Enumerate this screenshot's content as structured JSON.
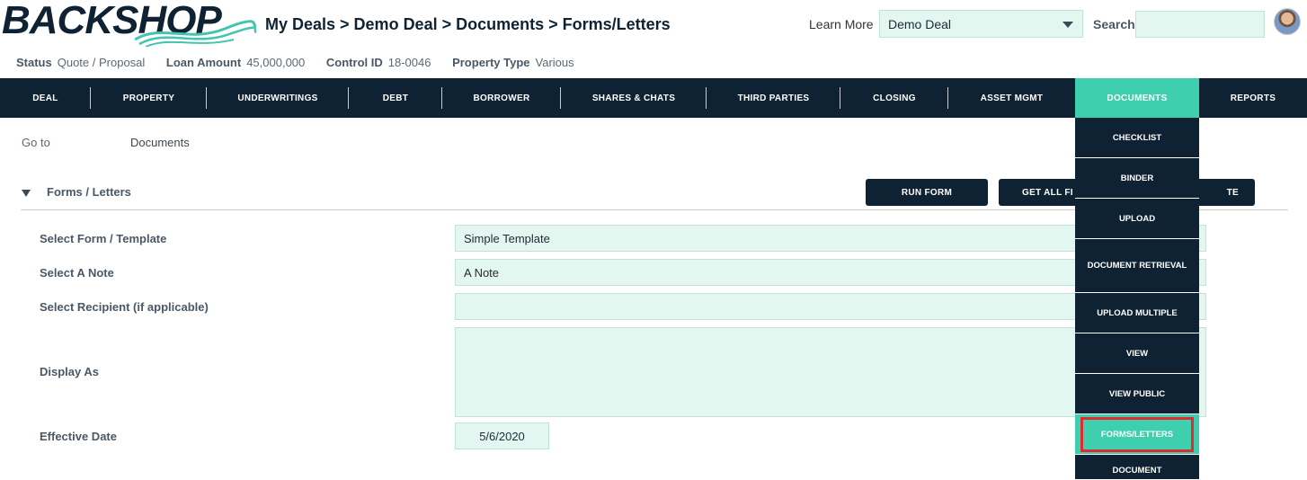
{
  "header": {
    "logo_text": "BACKSHOP",
    "breadcrumb": "My Deals > Demo Deal > Documents > Forms/Letters",
    "learn_more": "Learn More",
    "deal_select": "Demo Deal",
    "search_label": "Search",
    "search_value": ""
  },
  "status": [
    {
      "label": "Status",
      "value": "Quote / Proposal"
    },
    {
      "label": "Loan Amount",
      "value": "45,000,000"
    },
    {
      "label": "Control ID",
      "value": "18-0046"
    },
    {
      "label": "Property Type",
      "value": "Various"
    }
  ],
  "nav": [
    {
      "label": "DEAL"
    },
    {
      "label": "PROPERTY"
    },
    {
      "label": "UNDERWRITINGS"
    },
    {
      "label": "DEBT"
    },
    {
      "label": "BORROWER"
    },
    {
      "label": "SHARES & CHATS"
    },
    {
      "label": "THIRD PARTIES"
    },
    {
      "label": "CLOSING"
    },
    {
      "label": "ASSET MGMT"
    },
    {
      "label": "DOCUMENTS"
    },
    {
      "label": "REPORTS"
    }
  ],
  "dropdown": [
    {
      "label": "CHECKLIST"
    },
    {
      "label": "BINDER"
    },
    {
      "label": "UPLOAD"
    },
    {
      "label": "DOCUMENT RETRIEVAL"
    },
    {
      "label": "UPLOAD MULTIPLE"
    },
    {
      "label": "VIEW"
    },
    {
      "label": "VIEW PUBLIC"
    },
    {
      "label": "FORMS/LETTERS"
    },
    {
      "label": "DOCUMENT"
    }
  ],
  "content": {
    "goto_label": "Go to",
    "goto_value": "Documents",
    "section_title": "Forms / Letters",
    "run_form": "RUN FORM",
    "get_all": "GET ALL FI",
    "get_all_tail": "TE",
    "fields": {
      "form_label": "Select Form / Template",
      "form_value": "Simple Template",
      "note_label": "Select A Note",
      "note_value": "A Note",
      "recipient_label": "Select Recipient (if applicable)",
      "recipient_value": "",
      "display_label": "Display As",
      "display_value": "",
      "date_label": "Effective Date",
      "date_value": "5/6/2020"
    }
  },
  "colors": {
    "navy": "#0e2233",
    "teal": "#3ecfaf",
    "field_bg": "#e3f6f0",
    "highlight": "#e02a2f"
  }
}
